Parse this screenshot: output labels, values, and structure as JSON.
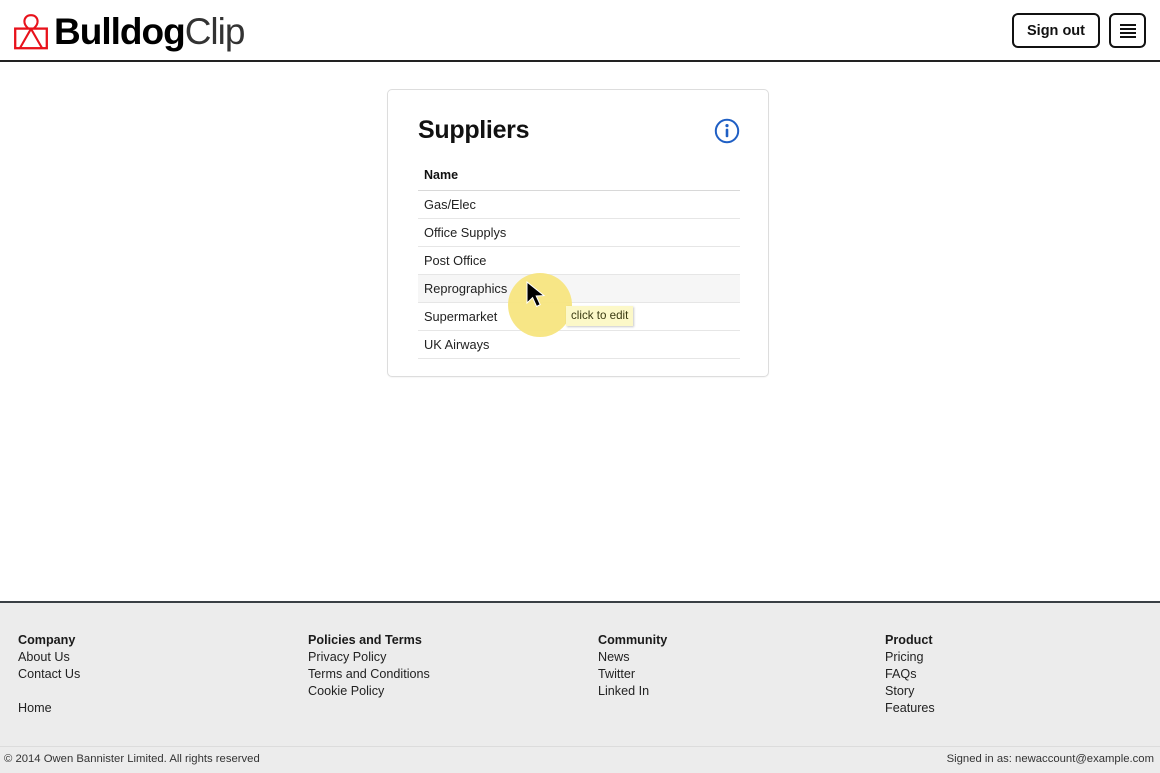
{
  "header": {
    "logo": {
      "icon": "bulldog-clip-icon",
      "icon_color": "#e8121b",
      "text_bold": "Bulldog",
      "text_light": "Clip"
    },
    "sign_out_label": "Sign out",
    "menu_icon": "hamburger-icon"
  },
  "card": {
    "title": "Suppliers",
    "info_icon": "info-circle-icon",
    "info_icon_color": "#1f5fc4",
    "table": {
      "columns": [
        "Name"
      ],
      "rows": [
        {
          "name": "Gas/Elec",
          "active": false
        },
        {
          "name": "Office Supplys",
          "active": false
        },
        {
          "name": "Post Office",
          "active": false
        },
        {
          "name": "Reprographics",
          "active": true
        },
        {
          "name": "Supermarket",
          "active": false
        },
        {
          "name": "UK Airways",
          "active": false
        }
      ]
    }
  },
  "cursor": {
    "tooltip": "click to edit",
    "halo_color": "#f7e57f",
    "tooltip_bg": "#fcf8c8"
  },
  "footer": {
    "columns": [
      {
        "title": "Company",
        "links": [
          "About Us",
          "Contact Us"
        ],
        "extra_links": [
          "Home"
        ]
      },
      {
        "title": "Policies and Terms",
        "links": [
          "Privacy Policy",
          "Terms and Conditions",
          "Cookie Policy"
        ],
        "extra_links": []
      },
      {
        "title": "Community",
        "links": [
          "News",
          "Twitter",
          "Linked In"
        ],
        "extra_links": []
      },
      {
        "title": "Product",
        "links": [
          "Pricing",
          "FAQs",
          "Story",
          "Features"
        ],
        "extra_links": []
      }
    ],
    "copyright": "© 2014 Owen Bannister Limited. All rights reserved",
    "signed_in": "Signed in as: newaccount@example.com"
  }
}
